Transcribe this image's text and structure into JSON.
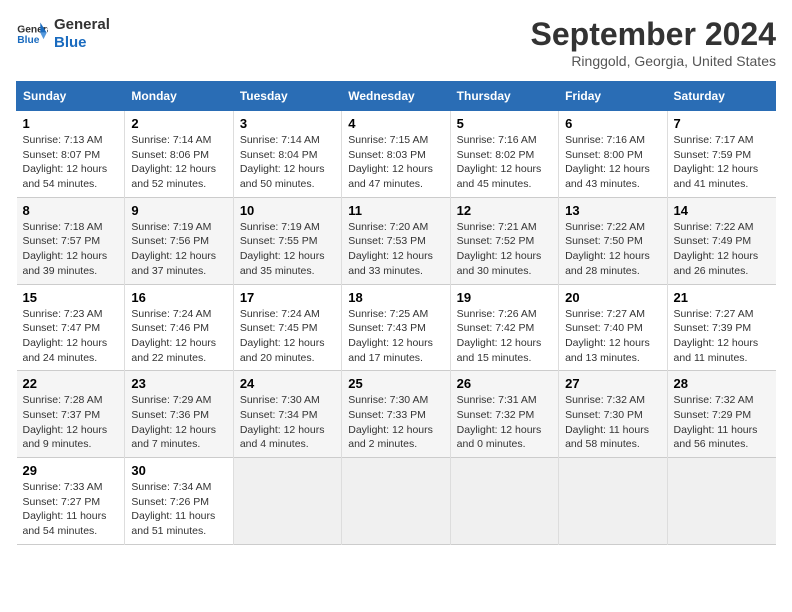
{
  "header": {
    "logo_line1": "General",
    "logo_line2": "Blue",
    "title": "September 2024",
    "subtitle": "Ringgold, Georgia, United States"
  },
  "calendar": {
    "columns": [
      "Sunday",
      "Monday",
      "Tuesday",
      "Wednesday",
      "Thursday",
      "Friday",
      "Saturday"
    ],
    "weeks": [
      [
        {
          "day": "",
          "empty": true
        },
        {
          "day": "",
          "empty": true
        },
        {
          "day": "",
          "empty": true
        },
        {
          "day": "",
          "empty": true
        },
        {
          "day": "",
          "empty": true
        },
        {
          "day": "",
          "empty": true
        },
        {
          "day": "",
          "empty": true
        }
      ],
      [
        {
          "day": "1",
          "sunrise": "Sunrise: 7:13 AM",
          "sunset": "Sunset: 8:07 PM",
          "daylight": "Daylight: 12 hours and 54 minutes."
        },
        {
          "day": "2",
          "sunrise": "Sunrise: 7:14 AM",
          "sunset": "Sunset: 8:06 PM",
          "daylight": "Daylight: 12 hours and 52 minutes."
        },
        {
          "day": "3",
          "sunrise": "Sunrise: 7:14 AM",
          "sunset": "Sunset: 8:04 PM",
          "daylight": "Daylight: 12 hours and 50 minutes."
        },
        {
          "day": "4",
          "sunrise": "Sunrise: 7:15 AM",
          "sunset": "Sunset: 8:03 PM",
          "daylight": "Daylight: 12 hours and 47 minutes."
        },
        {
          "day": "5",
          "sunrise": "Sunrise: 7:16 AM",
          "sunset": "Sunset: 8:02 PM",
          "daylight": "Daylight: 12 hours and 45 minutes."
        },
        {
          "day": "6",
          "sunrise": "Sunrise: 7:16 AM",
          "sunset": "Sunset: 8:00 PM",
          "daylight": "Daylight: 12 hours and 43 minutes."
        },
        {
          "day": "7",
          "sunrise": "Sunrise: 7:17 AM",
          "sunset": "Sunset: 7:59 PM",
          "daylight": "Daylight: 12 hours and 41 minutes."
        }
      ],
      [
        {
          "day": "8",
          "sunrise": "Sunrise: 7:18 AM",
          "sunset": "Sunset: 7:57 PM",
          "daylight": "Daylight: 12 hours and 39 minutes."
        },
        {
          "day": "9",
          "sunrise": "Sunrise: 7:19 AM",
          "sunset": "Sunset: 7:56 PM",
          "daylight": "Daylight: 12 hours and 37 minutes."
        },
        {
          "day": "10",
          "sunrise": "Sunrise: 7:19 AM",
          "sunset": "Sunset: 7:55 PM",
          "daylight": "Daylight: 12 hours and 35 minutes."
        },
        {
          "day": "11",
          "sunrise": "Sunrise: 7:20 AM",
          "sunset": "Sunset: 7:53 PM",
          "daylight": "Daylight: 12 hours and 33 minutes."
        },
        {
          "day": "12",
          "sunrise": "Sunrise: 7:21 AM",
          "sunset": "Sunset: 7:52 PM",
          "daylight": "Daylight: 12 hours and 30 minutes."
        },
        {
          "day": "13",
          "sunrise": "Sunrise: 7:22 AM",
          "sunset": "Sunset: 7:50 PM",
          "daylight": "Daylight: 12 hours and 28 minutes."
        },
        {
          "day": "14",
          "sunrise": "Sunrise: 7:22 AM",
          "sunset": "Sunset: 7:49 PM",
          "daylight": "Daylight: 12 hours and 26 minutes."
        }
      ],
      [
        {
          "day": "15",
          "sunrise": "Sunrise: 7:23 AM",
          "sunset": "Sunset: 7:47 PM",
          "daylight": "Daylight: 12 hours and 24 minutes."
        },
        {
          "day": "16",
          "sunrise": "Sunrise: 7:24 AM",
          "sunset": "Sunset: 7:46 PM",
          "daylight": "Daylight: 12 hours and 22 minutes."
        },
        {
          "day": "17",
          "sunrise": "Sunrise: 7:24 AM",
          "sunset": "Sunset: 7:45 PM",
          "daylight": "Daylight: 12 hours and 20 minutes."
        },
        {
          "day": "18",
          "sunrise": "Sunrise: 7:25 AM",
          "sunset": "Sunset: 7:43 PM",
          "daylight": "Daylight: 12 hours and 17 minutes."
        },
        {
          "day": "19",
          "sunrise": "Sunrise: 7:26 AM",
          "sunset": "Sunset: 7:42 PM",
          "daylight": "Daylight: 12 hours and 15 minutes."
        },
        {
          "day": "20",
          "sunrise": "Sunrise: 7:27 AM",
          "sunset": "Sunset: 7:40 PM",
          "daylight": "Daylight: 12 hours and 13 minutes."
        },
        {
          "day": "21",
          "sunrise": "Sunrise: 7:27 AM",
          "sunset": "Sunset: 7:39 PM",
          "daylight": "Daylight: 12 hours and 11 minutes."
        }
      ],
      [
        {
          "day": "22",
          "sunrise": "Sunrise: 7:28 AM",
          "sunset": "Sunset: 7:37 PM",
          "daylight": "Daylight: 12 hours and 9 minutes."
        },
        {
          "day": "23",
          "sunrise": "Sunrise: 7:29 AM",
          "sunset": "Sunset: 7:36 PM",
          "daylight": "Daylight: 12 hours and 7 minutes."
        },
        {
          "day": "24",
          "sunrise": "Sunrise: 7:30 AM",
          "sunset": "Sunset: 7:34 PM",
          "daylight": "Daylight: 12 hours and 4 minutes."
        },
        {
          "day": "25",
          "sunrise": "Sunrise: 7:30 AM",
          "sunset": "Sunset: 7:33 PM",
          "daylight": "Daylight: 12 hours and 2 minutes."
        },
        {
          "day": "26",
          "sunrise": "Sunrise: 7:31 AM",
          "sunset": "Sunset: 7:32 PM",
          "daylight": "Daylight: 12 hours and 0 minutes."
        },
        {
          "day": "27",
          "sunrise": "Sunrise: 7:32 AM",
          "sunset": "Sunset: 7:30 PM",
          "daylight": "Daylight: 11 hours and 58 minutes."
        },
        {
          "day": "28",
          "sunrise": "Sunrise: 7:32 AM",
          "sunset": "Sunset: 7:29 PM",
          "daylight": "Daylight: 11 hours and 56 minutes."
        }
      ],
      [
        {
          "day": "29",
          "sunrise": "Sunrise: 7:33 AM",
          "sunset": "Sunset: 7:27 PM",
          "daylight": "Daylight: 11 hours and 54 minutes."
        },
        {
          "day": "30",
          "sunrise": "Sunrise: 7:34 AM",
          "sunset": "Sunset: 7:26 PM",
          "daylight": "Daylight: 11 hours and 51 minutes."
        },
        {
          "day": "",
          "empty": true
        },
        {
          "day": "",
          "empty": true
        },
        {
          "day": "",
          "empty": true
        },
        {
          "day": "",
          "empty": true
        },
        {
          "day": "",
          "empty": true
        }
      ]
    ]
  }
}
